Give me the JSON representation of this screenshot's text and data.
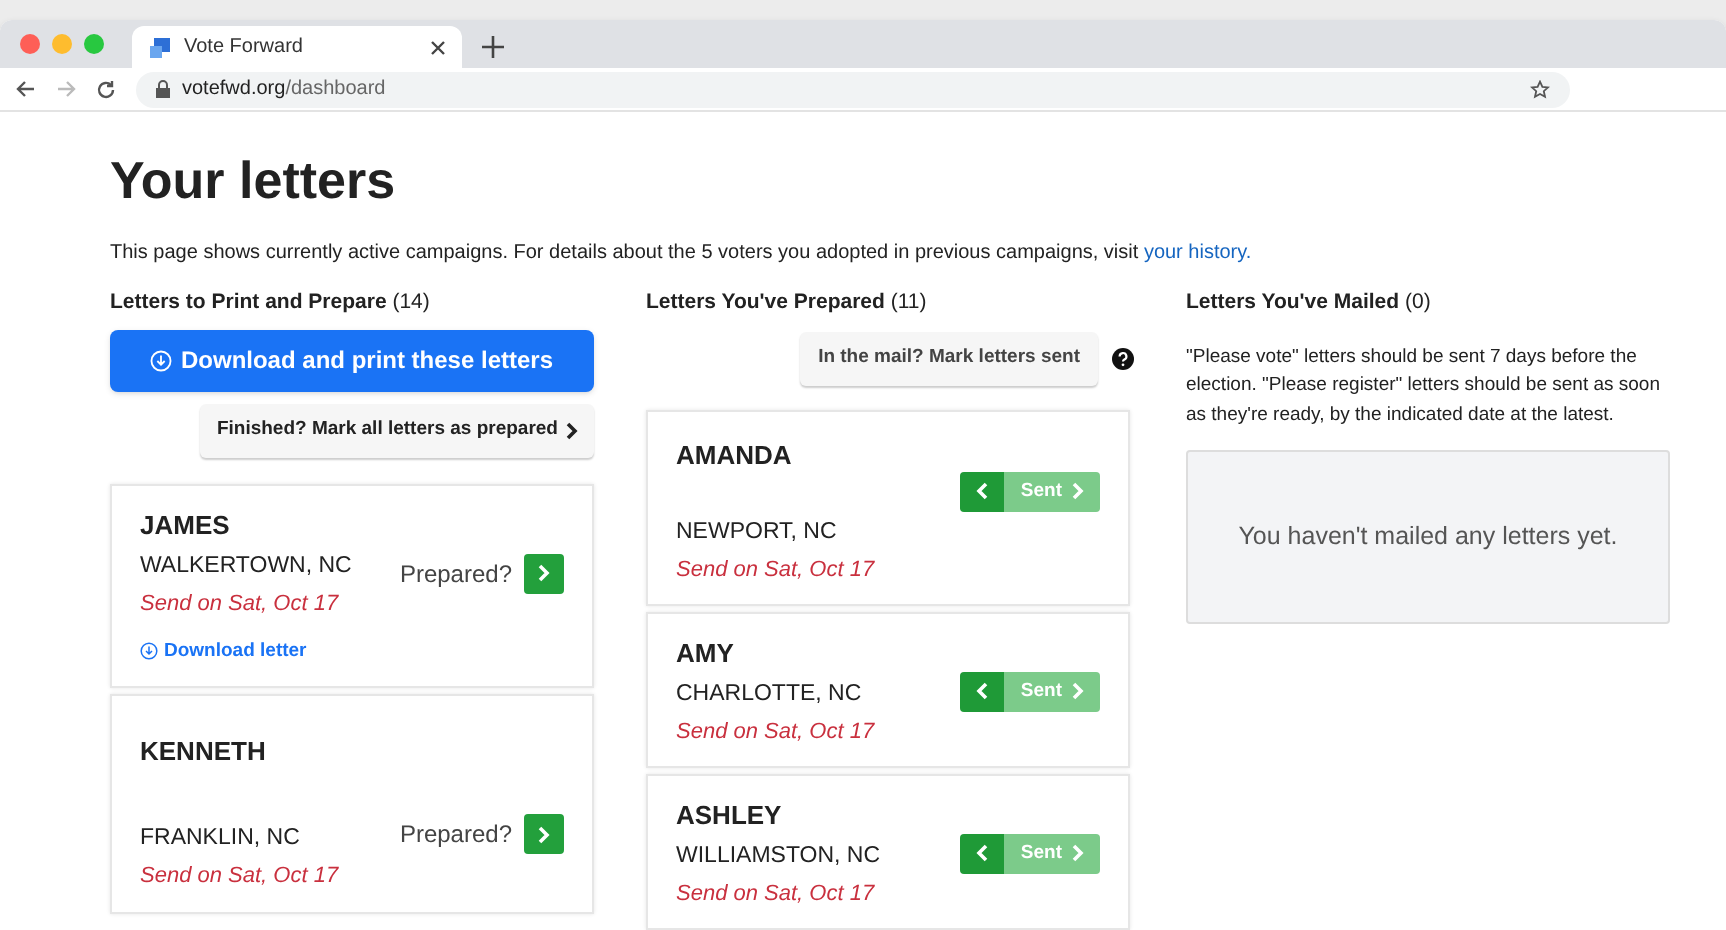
{
  "browser": {
    "tab_title": "Vote Forward",
    "url_domain": "votefwd.org",
    "url_path": "/dashboard"
  },
  "page": {
    "title": "Your letters",
    "intro": "This page shows currently active campaigns. For details about the 5 voters you adopted in previous campaigns, visit ",
    "intro_link": "your history."
  },
  "to_prepare": {
    "heading": "Letters to Print and Prepare",
    "count": "(14)",
    "download_button": "Download and print these letters",
    "mark_button": "Finished? Mark all letters as prepared",
    "letters": [
      {
        "name": "JAMES",
        "location": "WALKERTOWN, NC",
        "send_date": "Send on Sat, Oct 17",
        "prepared_label": "Prepared?",
        "download_link": "Download letter"
      },
      {
        "name": "KENNETH",
        "location": "FRANKLIN, NC",
        "send_date": "Send on Sat, Oct 17",
        "prepared_label": "Prepared?"
      }
    ]
  },
  "prepared": {
    "heading": "Letters You've Prepared",
    "count": "(11)",
    "mark_button": "In the mail? Mark letters sent",
    "letters": [
      {
        "name": "AMANDA",
        "location": "NEWPORT, NC",
        "send_date": "Send on Sat, Oct 17",
        "sent_label": "Sent"
      },
      {
        "name": "AMY",
        "location": "CHARLOTTE, NC",
        "send_date": "Send on Sat, Oct 17",
        "sent_label": "Sent"
      },
      {
        "name": "ASHLEY",
        "location": "WILLIAMSTON, NC",
        "send_date": "Send on Sat, Oct 17",
        "sent_label": "Sent"
      }
    ]
  },
  "mailed": {
    "heading": "Letters You've Mailed",
    "count": "(0)",
    "note": "\"Please vote\" letters should be sent 7 days before the election. \"Please register\" letters should be sent as soon as they're ready, by the indicated date at the latest.",
    "empty_message": "You haven't mailed any letters yet."
  }
}
